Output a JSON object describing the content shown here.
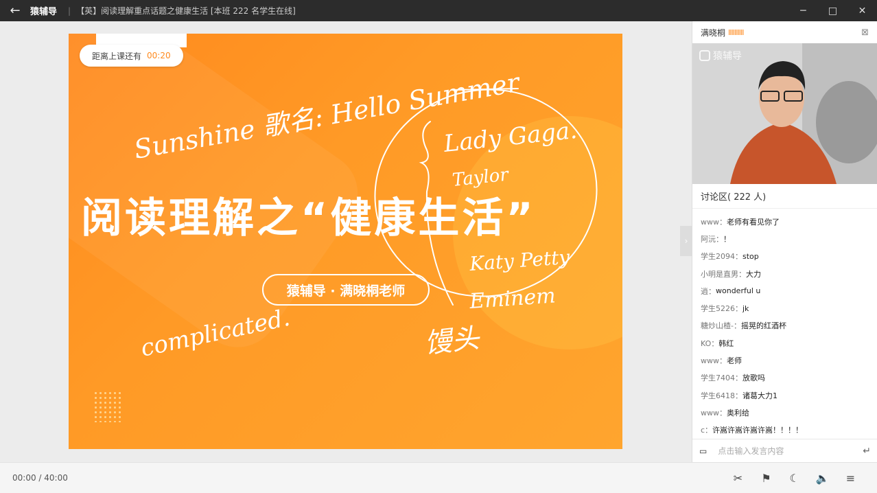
{
  "titlebar": {
    "back_icon": "←",
    "brand": "猿辅导",
    "separator": "|",
    "title": "【英】阅读理解重点话题之健康生活 [本班 222 名学生在线]",
    "minimize": "─",
    "maximize": "□",
    "close": "✕"
  },
  "slide": {
    "countdown_label": "距离上课还有",
    "countdown_time": "00:20",
    "headline": "阅读理解之“健康生活”",
    "teacher": "猿辅导 · 满晓桐老师",
    "handwriting": {
      "line1": "Sunshine 歌名: Hello Summer",
      "artist1": "Lady Gaga.",
      "artist2": "Taylor",
      "artist3": "Katy Petty",
      "artist4": "Eminem",
      "word": "complicated.",
      "note": "馒头"
    }
  },
  "camera": {
    "name": "满晓桐",
    "signal": "IIIIIIIIII",
    "cam_toggle_icon": "⊠",
    "watermark": "猿辅导"
  },
  "chat": {
    "header": "讨论区( 222 人)",
    "messages": [
      {
        "user": "www：",
        "text": "老师有看见你了"
      },
      {
        "user": "阿沅：",
        "text": "！"
      },
      {
        "user": "学生2094：",
        "text": "stop"
      },
      {
        "user": "小明是直男：",
        "text": "大力"
      },
      {
        "user": "逍：",
        "text": "wonderful u"
      },
      {
        "user": "学生5226：",
        "text": "jk"
      },
      {
        "user": "糖炒山楂-：",
        "text": "摇晃的红酒杯"
      },
      {
        "user": "KO：",
        "text": "韩红"
      },
      {
        "user": "www：",
        "text": "老师"
      },
      {
        "user": "学生7404：",
        "text": "放歌吗"
      },
      {
        "user": "学生6418：",
        "text": "诸葛大力1"
      },
      {
        "user": "www：",
        "text": "奥利给"
      },
      {
        "user": "c：",
        "text": "许嵩许嵩许嵩许嵩！！！！"
      }
    ],
    "input_placeholder": "点击输入发言内容",
    "expand_icon": "›",
    "emoji_icon": "▭",
    "enter_icon": "↵"
  },
  "bottombar": {
    "time": "00:00 / 40:00",
    "tools": [
      "✂",
      "⚑",
      "☾",
      "🔈",
      "≡"
    ]
  }
}
